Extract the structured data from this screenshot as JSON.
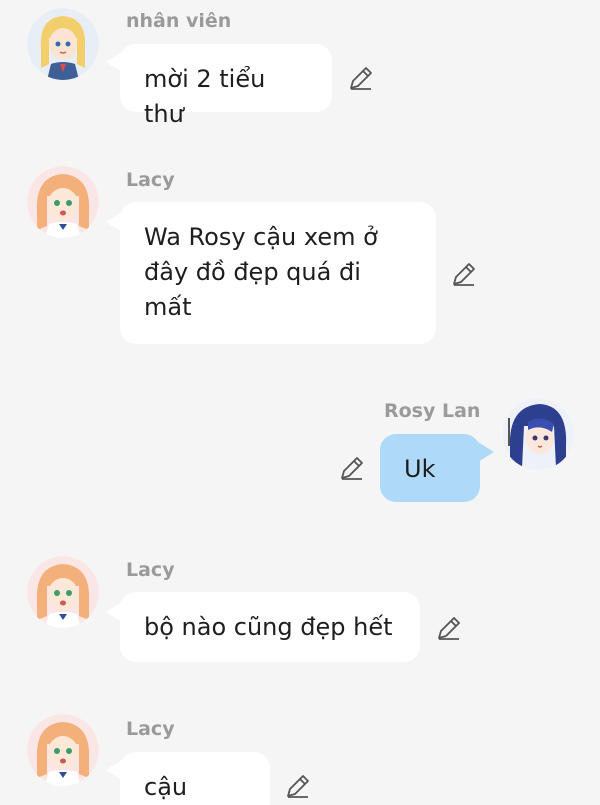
{
  "messages": [
    {
      "sender": "nhân viên",
      "text": "mời 2 tiểu thư",
      "side": "left",
      "avatar": "blonde-girl-avatar"
    },
    {
      "sender": "Lacy",
      "text": "Wa Rosy cậu xem ở đây đồ đẹp quá đi mất",
      "side": "left",
      "avatar": "orange-hair-girl-avatar"
    },
    {
      "sender": "Rosy Lan",
      "text": "Uk",
      "side": "right",
      "avatar": "blue-hair-girl-avatar"
    },
    {
      "sender": "Lacy",
      "text": "bộ nào cũng đẹp hết",
      "side": "left",
      "avatar": "orange-hair-girl-avatar"
    },
    {
      "sender": "Lacy",
      "text": "cậu xem",
      "side": "left",
      "avatar": "orange-hair-girl-avatar"
    }
  ],
  "icons": {
    "edit": "pencil-icon"
  },
  "colors": {
    "background": "#f5f5f5",
    "left_bubble": "#ffffff",
    "right_bubble": "#aed9f8",
    "sender_name": "#9a9a9a"
  }
}
